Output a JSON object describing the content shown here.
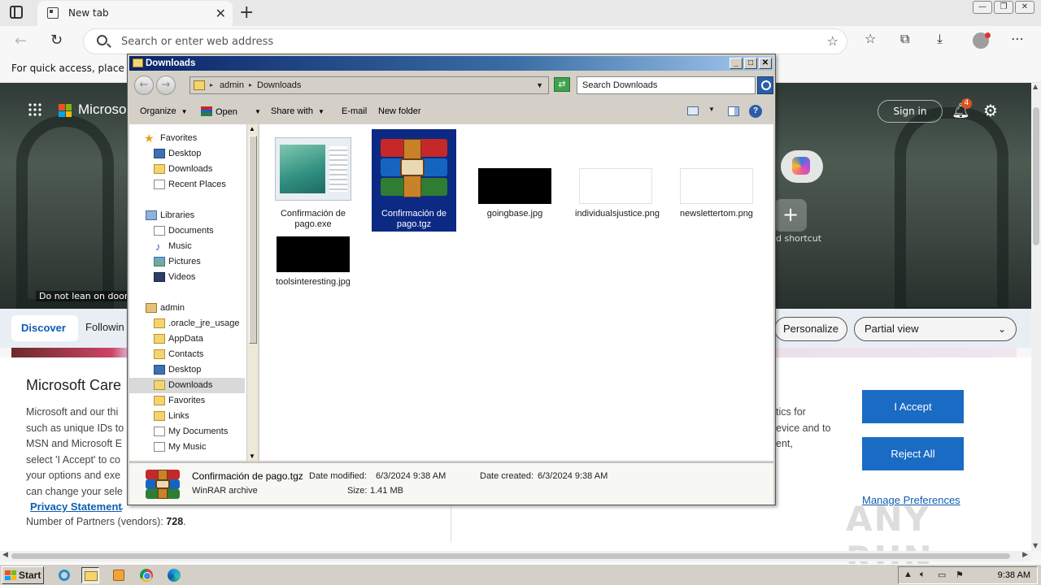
{
  "browser": {
    "tab_title": "New tab",
    "address_placeholder": "Search or enter web address",
    "favbar_text": "For quick access, place you"
  },
  "newtab_page": {
    "brand": "Microso",
    "door_warning": "Do not lean on door",
    "sign_in": "Sign in",
    "notification_count": "4",
    "add_shortcut": "d shortcut",
    "feed_tabs": {
      "discover": "Discover",
      "following": "Followin"
    },
    "personalize": "Personalize",
    "view_select": "Partial view"
  },
  "consent": {
    "title": "Microsoft Care",
    "body_left": [
      "Microsoft and our thi",
      "such as unique IDs to",
      "MSN and Microsoft E",
      "select 'I Accept' to co",
      "your options and exe",
      "can change your sele"
    ],
    "privacy_link": "Privacy Statement",
    "privacy_suffix": ".",
    "partners_label": "Number of Partners (vendors):",
    "partners_count": "728",
    "partners_suffix": ".",
    "body_right": [
      "tics for",
      "evice and to",
      "ent,"
    ],
    "accept": "I Accept",
    "reject": "Reject All",
    "manage": "Manage Preferences"
  },
  "watermark": "ANY RUN",
  "explorer": {
    "title": "Downloads",
    "breadcrumb": [
      "admin",
      "Downloads"
    ],
    "search_placeholder": "Search Downloads",
    "toolbar": {
      "organize": "Organize",
      "open": "Open",
      "share_with": "Share with",
      "email": "E-mail",
      "new_folder": "New folder"
    },
    "nav": {
      "favorites": "Favorites",
      "fav_items": [
        "Desktop",
        "Downloads",
        "Recent Places"
      ],
      "libraries": "Libraries",
      "lib_items": [
        "Documents",
        "Music",
        "Pictures",
        "Videos"
      ],
      "user": "admin",
      "user_items": [
        ".oracle_jre_usage",
        "AppData",
        "Contacts",
        "Desktop",
        "Downloads",
        "Favorites",
        "Links",
        "My Documents",
        "My Music"
      ]
    },
    "files": [
      {
        "name": "Confirmación de pago.exe",
        "type": "exe"
      },
      {
        "name": "Confirmación de pago.tgz",
        "type": "rar",
        "selected": true
      },
      {
        "name": "goingbase.jpg",
        "type": "black"
      },
      {
        "name": "individualsjustice.png",
        "type": "white"
      },
      {
        "name": "newslettertom.png",
        "type": "white"
      },
      {
        "name": "toolsinteresting.jpg",
        "type": "black"
      }
    ],
    "details": {
      "name": "Confirmación de pago.tgz",
      "type": "WinRAR archive",
      "modified_label": "Date modified:",
      "modified": "6/3/2024 9:38 AM",
      "created_label": "Date created:",
      "created": "6/3/2024 9:38 AM",
      "size_label": "Size:",
      "size": "1.41 MB"
    }
  },
  "taskbar": {
    "start": "Start",
    "clock": "9:38 AM"
  }
}
